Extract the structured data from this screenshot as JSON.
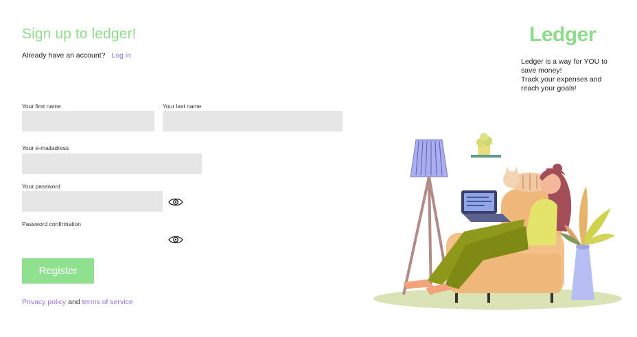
{
  "form": {
    "title": "Sign up to ledger!",
    "have_account_text": "Already have an account?",
    "login_link": "Log in",
    "first_name_label": "Your first name",
    "first_name_value": "",
    "last_name_label": "Your last name",
    "last_name_value": "",
    "email_label": "Your e-mailadress",
    "email_value": "",
    "password_label": "Your password",
    "password_value": "",
    "password_confirm_label": "Password confirmation",
    "password_confirm_value": "",
    "register_button": "Register",
    "legal": {
      "privacy_link": "Privacy policy",
      "and_text": " and ",
      "terms_link": "terms of service"
    }
  },
  "brand": {
    "logo_text": "Ledger",
    "tagline_lines": [
      "Ledger is a way for YOU to save money!",
      "Track your  expenses and reach your goals!"
    ]
  },
  "icons": {
    "password_toggle": "eye-icon",
    "password_confirm_toggle": "eye-icon"
  },
  "colors": {
    "accent_green": "#8fdb8c",
    "link_purple": "#8b6fd6",
    "field_gray": "#e6e6e6"
  }
}
